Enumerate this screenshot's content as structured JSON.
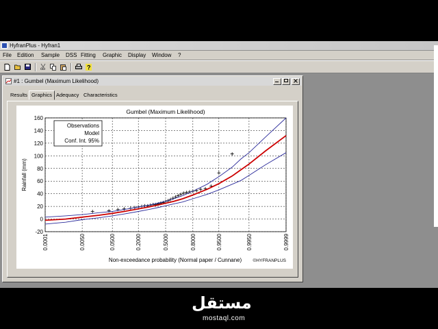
{
  "app": {
    "title": "HyfranPlus - Hyfran1",
    "menus": [
      "File",
      "Edition",
      "Sample",
      "DSS",
      "Fitting",
      "Graphic",
      "Display",
      "Window",
      "?"
    ]
  },
  "document": {
    "title": "#1 : Gumbel (Maximum Likelihood)",
    "tabs": [
      "Results",
      "Graphics",
      "Adequacy",
      "Characteristics"
    ],
    "active_tab": "Graphics"
  },
  "chart_data": {
    "type": "scatter",
    "title": "Gumbel (Maximum Likelihood)",
    "xlabel": "Non-exceedance probability (Normal paper / Cunnane)",
    "ylabel": "Rainfall (mm)",
    "x_scale": "normal-probability",
    "xlim": [
      0.0001,
      0.9999
    ],
    "ylim": [
      -20,
      160
    ],
    "x_ticks": [
      "0.0001",
      "0.0050",
      "0.0500",
      "0.2000",
      "0.5000",
      "0.8000",
      "0.9500",
      "0.9950",
      "0.9999"
    ],
    "y_ticks": [
      -20,
      0,
      20,
      40,
      60,
      80,
      100,
      120,
      140,
      160
    ],
    "grid": true,
    "legend_placement": "top-left",
    "legend": [
      "Observations",
      "Model",
      "Conf. Int. 95%"
    ],
    "watermark": "©HYFRANPLUS",
    "series": [
      {
        "name": "Observations",
        "style": "plus",
        "color": "#000000",
        "x": [
          0.012,
          0.04,
          0.07,
          0.1,
          0.14,
          0.17,
          0.2,
          0.23,
          0.26,
          0.29,
          0.32,
          0.35,
          0.38,
          0.41,
          0.44,
          0.47,
          0.5,
          0.53,
          0.56,
          0.59,
          0.62,
          0.65,
          0.68,
          0.71,
          0.74,
          0.77,
          0.8,
          0.83,
          0.86,
          0.89,
          0.92,
          0.95,
          0.98
        ],
        "y": [
          12,
          13,
          15,
          16,
          17,
          18,
          19,
          20,
          21,
          21,
          22,
          23,
          23,
          24,
          25,
          26,
          28,
          29,
          31,
          33,
          35,
          37,
          39,
          41,
          42,
          43,
          44,
          45,
          47,
          48,
          52,
          73,
          103
        ]
      },
      {
        "name": "Model",
        "style": "line",
        "color": "#cc0000",
        "x": [
          0.0001,
          0.001,
          0.005,
          0.02,
          0.05,
          0.1,
          0.2,
          0.3,
          0.4,
          0.5,
          0.6,
          0.7,
          0.8,
          0.9,
          0.95,
          0.98,
          0.99,
          0.995,
          0.999,
          0.9999
        ],
        "y": [
          -2,
          0,
          3,
          6,
          9,
          12,
          16,
          19,
          22,
          25,
          28,
          32,
          38,
          47,
          56,
          68,
          78,
          87,
          108,
          132
        ]
      },
      {
        "name": "Conf. Int. 95% upper",
        "style": "line",
        "color": "#2a2a9a",
        "x": [
          0.0001,
          0.001,
          0.005,
          0.02,
          0.05,
          0.1,
          0.2,
          0.3,
          0.4,
          0.5,
          0.6,
          0.7,
          0.8,
          0.9,
          0.95,
          0.98,
          0.99,
          0.995,
          0.999,
          0.9999
        ],
        "y": [
          3,
          5,
          7,
          10,
          12,
          15,
          19,
          22,
          25,
          28,
          32,
          37,
          44,
          55,
          67,
          82,
          95,
          105,
          130,
          160
        ]
      },
      {
        "name": "Conf. Int. 95% lower",
        "style": "line",
        "color": "#2a2a9a",
        "x": [
          0.0001,
          0.001,
          0.005,
          0.02,
          0.05,
          0.1,
          0.2,
          0.3,
          0.4,
          0.5,
          0.6,
          0.7,
          0.8,
          0.9,
          0.95,
          0.98,
          0.99,
          0.995,
          0.999,
          0.9999
        ],
        "y": [
          -8,
          -5,
          -1,
          2,
          5,
          8,
          12,
          15,
          18,
          21,
          24,
          27,
          32,
          39,
          46,
          55,
          61,
          69,
          86,
          105
        ]
      }
    ]
  },
  "watermark_logo": {
    "arabic": "مستقل",
    "latin": "mostaql.com"
  }
}
